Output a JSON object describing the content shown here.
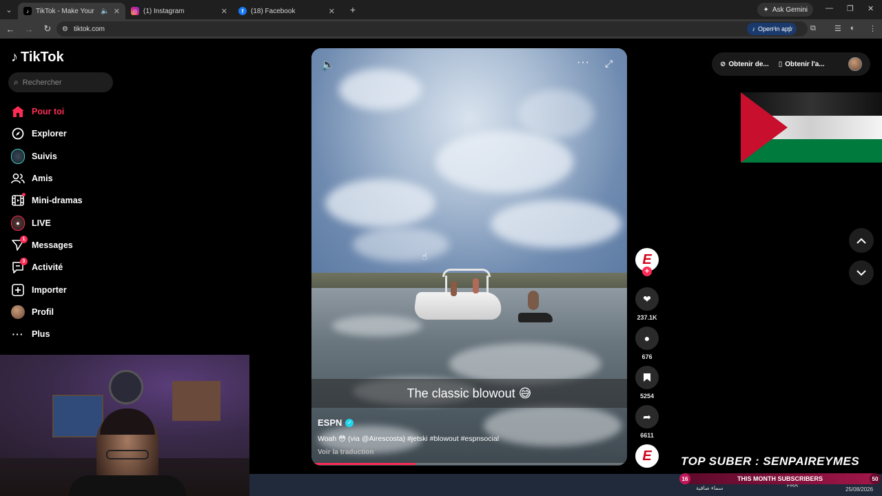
{
  "browser": {
    "tabs": [
      {
        "title": "TikTok - Make Your Day",
        "favicon": "tiktok-icon",
        "active": true
      },
      {
        "title": "(1) Instagram",
        "favicon": "instagram-icon",
        "active": false
      },
      {
        "title": "(18) Facebook",
        "favicon": "facebook-icon",
        "active": false
      }
    ],
    "gemini_label": "Ask Gemini",
    "url": "tiktok.com",
    "open_in_app": "Open in app"
  },
  "sidebar": {
    "logo_text": "TikTok",
    "search_placeholder": "Rechercher",
    "items": [
      {
        "label": "Pour toi",
        "icon": "home-icon"
      },
      {
        "label": "Explorer",
        "icon": "compass-icon"
      },
      {
        "label": "Suivis",
        "icon": "following-avatar-icon"
      },
      {
        "label": "Amis",
        "icon": "friends-icon"
      },
      {
        "label": "Mini-dramas",
        "icon": "film-icon"
      },
      {
        "label": "LIVE",
        "icon": "live-icon"
      },
      {
        "label": "Messages",
        "icon": "send-icon",
        "badge": "1"
      },
      {
        "label": "Activité",
        "icon": "inbox-icon",
        "badge": "3"
      },
      {
        "label": "Importer",
        "icon": "plus-square-icon"
      },
      {
        "label": "Profil",
        "icon": "profile-avatar-icon"
      },
      {
        "label": "Plus",
        "icon": "more-icon"
      }
    ]
  },
  "video": {
    "caption": "The classic blowout 😅",
    "author": "ESPN",
    "description": "Woah 😳 (via @Airescosta) #jetski #blowout #espnsocial",
    "translate": "Voir la traduction",
    "progress_percent": 33
  },
  "actions": {
    "likes": "237.1K",
    "comments": "676",
    "saves": "5254",
    "shares": "6611"
  },
  "topright": {
    "item1": "Obtenir de...",
    "item2": "Obtenir l'a..."
  },
  "overlay": {
    "top_suber": "TOP SUBER : SENPAIREYMES",
    "subs_label": "THIS MONTH SUBSCRIBERS",
    "subs_left": "16",
    "subs_right": "50"
  },
  "taskbar": {
    "weather": "سماء صافية",
    "lang": "FRA",
    "time": "23:2",
    "date": "25/08/2026"
  },
  "colors": {
    "tiktok_red": "#fe2c55",
    "flag_red": "#c8102e",
    "flag_green": "#007a3d"
  }
}
